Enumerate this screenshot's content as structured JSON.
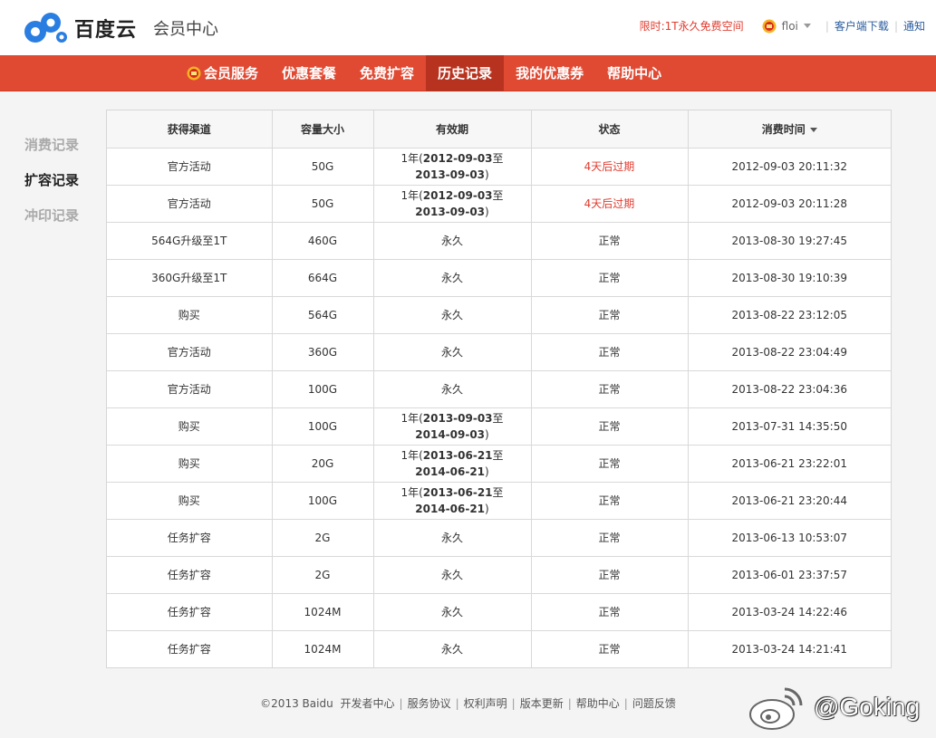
{
  "header": {
    "logo_text": "百度云",
    "logo_sub": "会员中心",
    "promo": "限时:1T永久免费空间",
    "username": "floi",
    "client_download": "客户端下载",
    "notifications": "通知"
  },
  "nav": {
    "items": [
      {
        "label": "会员服务"
      },
      {
        "label": "优惠套餐"
      },
      {
        "label": "免费扩容"
      },
      {
        "label": "历史记录"
      },
      {
        "label": "我的优惠券"
      },
      {
        "label": "帮助中心"
      }
    ]
  },
  "sidebar": {
    "items": [
      {
        "label": "消费记录"
      },
      {
        "label": "扩容记录"
      },
      {
        "label": "冲印记录"
      }
    ]
  },
  "table": {
    "headers": [
      "获得渠道",
      "容量大小",
      "有效期",
      "状态",
      "消费时间"
    ],
    "rows": [
      {
        "channel": "官方活动",
        "size": "50G",
        "validity_prefix": "1年(",
        "validity_start": "2012-09-03",
        "validity_mid": "至",
        "validity_end": "2013-09-03",
        "validity_suffix": ")",
        "status": "4天后过期",
        "time": "2012-09-03 20:11:32"
      },
      {
        "channel": "官方活动",
        "size": "50G",
        "validity_prefix": "1年(",
        "validity_start": "2012-09-03",
        "validity_mid": "至",
        "validity_end": "2013-09-03",
        "validity_suffix": ")",
        "status": "4天后过期",
        "time": "2012-09-03 20:11:28"
      },
      {
        "channel": "564G升级至1T",
        "size": "460G",
        "validity": "永久",
        "status": "正常",
        "time": "2013-08-30 19:27:45"
      },
      {
        "channel": "360G升级至1T",
        "size": "664G",
        "validity": "永久",
        "status": "正常",
        "time": "2013-08-30 19:10:39"
      },
      {
        "channel": "购买",
        "size": "564G",
        "validity": "永久",
        "status": "正常",
        "time": "2013-08-22 23:12:05"
      },
      {
        "channel": "官方活动",
        "size": "360G",
        "validity": "永久",
        "status": "正常",
        "time": "2013-08-22 23:04:49"
      },
      {
        "channel": "官方活动",
        "size": "100G",
        "validity": "永久",
        "status": "正常",
        "time": "2013-08-22 23:04:36"
      },
      {
        "channel": "购买",
        "size": "100G",
        "validity_prefix": "1年(",
        "validity_start": "2013-09-03",
        "validity_mid": "至",
        "validity_end": "2014-09-03",
        "validity_suffix": ")",
        "status": "正常",
        "time": "2013-07-31 14:35:50"
      },
      {
        "channel": "购买",
        "size": "20G",
        "validity_prefix": "1年(",
        "validity_start": "2013-06-21",
        "validity_mid": "至",
        "validity_end": "2014-06-21",
        "validity_suffix": ")",
        "status": "正常",
        "time": "2013-06-21 23:22:01"
      },
      {
        "channel": "购买",
        "size": "100G",
        "validity_prefix": "1年(",
        "validity_start": "2013-06-21",
        "validity_mid": "至",
        "validity_end": "2014-06-21",
        "validity_suffix": ")",
        "status": "正常",
        "time": "2013-06-21 23:20:44"
      },
      {
        "channel": "任务扩容",
        "size": "2G",
        "validity": "永久",
        "status": "正常",
        "time": "2013-06-13 10:53:07"
      },
      {
        "channel": "任务扩容",
        "size": "2G",
        "validity": "永久",
        "status": "正常",
        "time": "2013-06-01 23:37:57"
      },
      {
        "channel": "任务扩容",
        "size": "1024M",
        "validity": "永久",
        "status": "正常",
        "time": "2013-03-24 14:22:46"
      },
      {
        "channel": "任务扩容",
        "size": "1024M",
        "validity": "永久",
        "status": "正常",
        "time": "2013-03-24 14:21:41"
      }
    ]
  },
  "footer": {
    "copyright": "©2013 Baidu",
    "links": [
      "开发者中心",
      "服务协议",
      "权利声明",
      "版本更新",
      "帮助中心",
      "问题反馈"
    ]
  },
  "watermark": {
    "text": "@Goking"
  },
  "colors": {
    "accent_red": "#e04a33",
    "active_nav": "#b8331f",
    "status_warning": "#e03c2f",
    "link_blue": "#2b5c9e"
  }
}
